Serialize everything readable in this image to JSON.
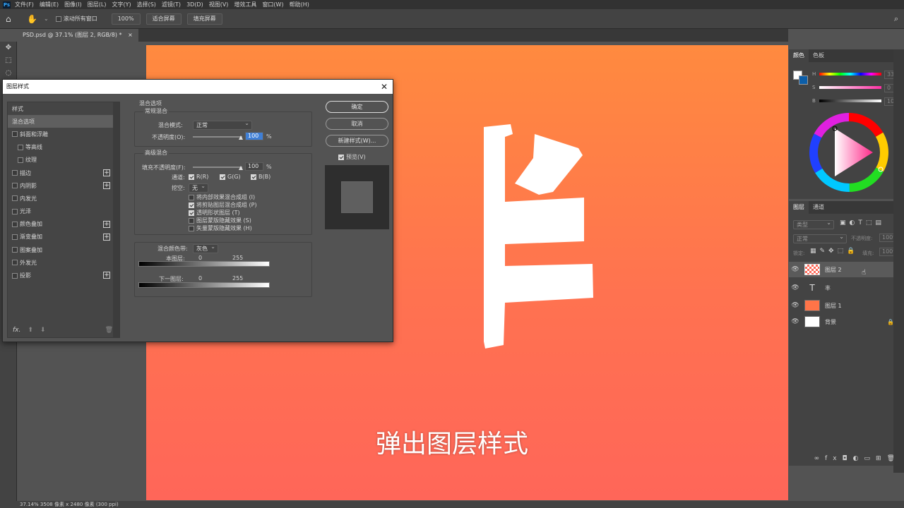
{
  "menubar": {
    "logo": "Ps",
    "items": [
      "文件(F)",
      "编辑(E)",
      "图像(I)",
      "图层(L)",
      "文字(Y)",
      "选择(S)",
      "滤镜(T)",
      "3D(D)",
      "视图(V)",
      "增效工具",
      "窗口(W)",
      "帮助(H)"
    ]
  },
  "optionsbar": {
    "scroll_all_label": "滚动所有窗口",
    "zoom": "100%",
    "fit_screen": "适合屏幕",
    "fill_screen": "填充屏幕"
  },
  "document": {
    "tab_title": "PSD.psd @ 37.1% (图层 2, RGB/8) *",
    "close": "×"
  },
  "subtitle": "弹出图层样式",
  "statusbar": "37.14%  3508 像素 x 2480 像素 (300 ppi)",
  "dialog": {
    "title": "图层样式",
    "close": "✕",
    "styles": [
      {
        "label": "样式",
        "plus": false,
        "checkbox": false,
        "indent": false,
        "selected": false
      },
      {
        "label": "混合选项",
        "plus": false,
        "checkbox": false,
        "indent": false,
        "selected": true
      },
      {
        "label": "斜面和浮雕",
        "plus": false,
        "checkbox": true,
        "indent": false,
        "selected": false
      },
      {
        "label": "等高线",
        "plus": false,
        "checkbox": true,
        "indent": true,
        "selected": false
      },
      {
        "label": "纹理",
        "plus": false,
        "checkbox": true,
        "indent": true,
        "selected": false
      },
      {
        "label": "描边",
        "plus": true,
        "checkbox": true,
        "indent": false,
        "selected": false
      },
      {
        "label": "内阴影",
        "plus": true,
        "checkbox": true,
        "indent": false,
        "selected": false
      },
      {
        "label": "内发光",
        "plus": false,
        "checkbox": true,
        "indent": false,
        "selected": false
      },
      {
        "label": "光泽",
        "plus": false,
        "checkbox": true,
        "indent": false,
        "selected": false
      },
      {
        "label": "颜色叠加",
        "plus": true,
        "checkbox": true,
        "indent": false,
        "selected": false
      },
      {
        "label": "渐变叠加",
        "plus": true,
        "checkbox": true,
        "indent": false,
        "selected": false
      },
      {
        "label": "图案叠加",
        "plus": false,
        "checkbox": true,
        "indent": false,
        "selected": false
      },
      {
        "label": "外发光",
        "plus": false,
        "checkbox": true,
        "indent": false,
        "selected": false
      },
      {
        "label": "投影",
        "plus": true,
        "checkbox": true,
        "indent": false,
        "selected": false
      }
    ],
    "footer_fx": "fx.",
    "blend": {
      "section_title": "混合选项",
      "general_title": "常规混合",
      "mode_label": "混合模式:",
      "mode_value": "正常",
      "opacity_label": "不透明度(O):",
      "opacity_value": "100",
      "percent": "%",
      "advanced_title": "高级混合",
      "fill_label": "填充不透明度(F):",
      "fill_value": "100",
      "channels_label": "通道:",
      "ch_r": "R(R)",
      "ch_g": "G(G)",
      "ch_b": "B(B)",
      "knockout_label": "挖空:",
      "knockout_value": "无",
      "opt1": "将内部效果混合成组 (I)",
      "opt2": "将剪贴图层混合成组 (P)",
      "opt3": "透明形状图层 (T)",
      "opt4": "图层蒙版隐藏效果 (S)",
      "opt5": "矢量蒙版隐藏效果 (H)",
      "blendif_label": "混合颜色带:",
      "blendif_value": "灰色",
      "this_layer": "本图层:",
      "under_layer": "下一图层:",
      "min": "0",
      "max": "255"
    },
    "buttons": {
      "ok": "确定",
      "cancel": "取消",
      "new_style": "新建样式(W)...",
      "preview": "预览(V)"
    }
  },
  "color_panel": {
    "tabs": [
      "颜色",
      "色板"
    ],
    "h_value": "335",
    "s_value": "0",
    "b_value": "100",
    "h_label": "H",
    "s_label": "S",
    "b_label": "B"
  },
  "layers_panel": {
    "tabs": [
      "图层",
      "通道"
    ],
    "filter_label": "类型",
    "blend_mode": "正常",
    "opacity_label": "不透明度:",
    "opacity_value": "100%",
    "lock_label": "锁定:",
    "fill_label": "填充:",
    "fill_value": "100%",
    "layers": [
      {
        "name": "图层 2",
        "thumb": "checker",
        "selected": true
      },
      {
        "name": "丰",
        "thumb": "text",
        "selected": false
      },
      {
        "name": "图层 1",
        "thumb": "orange",
        "selected": false
      },
      {
        "name": "背景",
        "thumb": "white",
        "selected": false
      }
    ]
  },
  "colors": {
    "canvas_top": "#ff8a3f",
    "canvas_bottom": "#ff6659",
    "accent_blue": "#31a8ff",
    "fg": "#ffffff",
    "bg": "#0c5ea8"
  }
}
